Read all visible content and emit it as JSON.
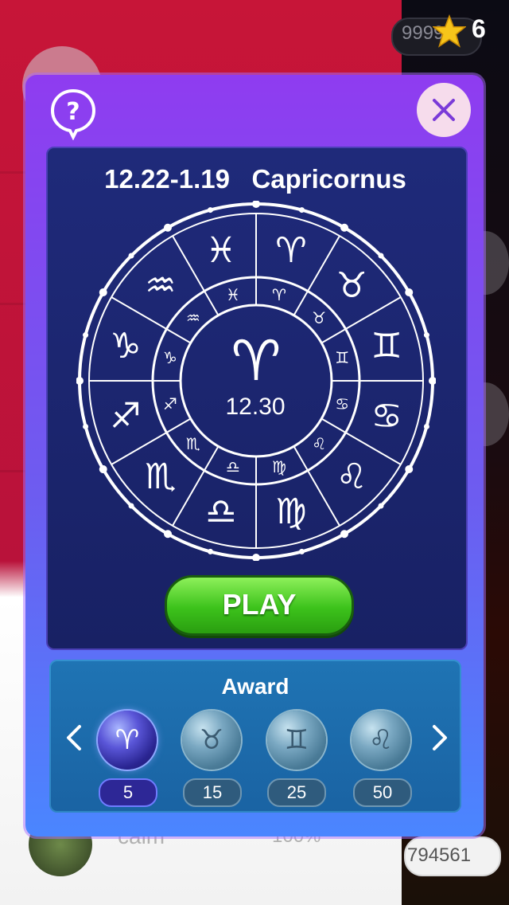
{
  "status_bar": {
    "counter_text": "9999",
    "stars": "6"
  },
  "background": {
    "player_name": "calm",
    "percent": "100%",
    "score": "794561"
  },
  "modal": {
    "title": "12.22-1.19   Capricornus",
    "center_value": "12.30",
    "center_sign": "aries-icon",
    "play_label": "PLAY",
    "award": {
      "title": "Award",
      "items": [
        {
          "sign": "aries-icon",
          "value": "5",
          "state": "active"
        },
        {
          "sign": "taurus-icon",
          "value": "15",
          "state": "locked"
        },
        {
          "sign": "gemini-icon",
          "value": "25",
          "state": "locked"
        },
        {
          "sign": "leo-icon",
          "value": "50",
          "state": "locked"
        }
      ]
    }
  },
  "colors": {
    "modal_top": "#8f3cf0",
    "modal_bottom": "#4a86ff",
    "board": "#1f2a7a",
    "play_green": "#3cc21b",
    "award_panel": "#1f74b4"
  }
}
